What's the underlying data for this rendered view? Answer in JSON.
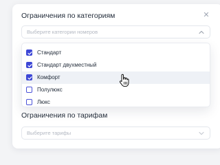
{
  "categories": {
    "title": "Ограничения по категориям",
    "placeholder": "Выберите категории номеров",
    "options": [
      {
        "label": "Стандарт",
        "checked": true
      },
      {
        "label": "Стандарт двухместный",
        "checked": true
      },
      {
        "label": "Комфорт",
        "checked": true
      },
      {
        "label": "Полулюкс",
        "checked": false
      },
      {
        "label": "Люкс",
        "checked": false
      }
    ]
  },
  "tariffs": {
    "title": "Ограничения по тарифам",
    "placeholder": "Выберите тарифы"
  },
  "close_symbol": "✕",
  "colors": {
    "accent": "#3d47d6",
    "hover_row": "#eef1f6"
  },
  "icons": {
    "close": "close-icon",
    "chevron_up": "chevron-up-icon",
    "chevron_down": "chevron-down-icon",
    "cursor": "hand-pointer-icon",
    "check": "check-icon"
  }
}
